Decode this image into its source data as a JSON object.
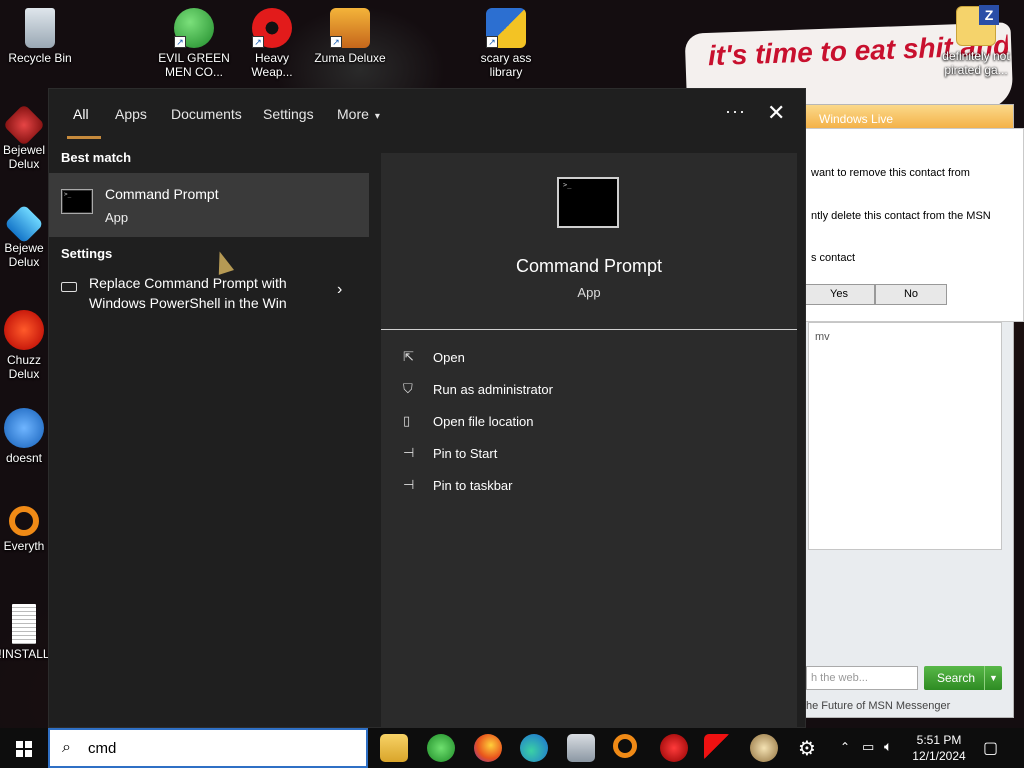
{
  "desktop": {
    "icons": [
      {
        "label": "Recycle Bin"
      },
      {
        "label": "EVIL GREEN MEN CO..."
      },
      {
        "label": "Heavy Weap..."
      },
      {
        "label": "Zuma Deluxe"
      },
      {
        "label": "scary ass library"
      },
      {
        "label": "definitely not pirated ga..."
      },
      {
        "label": "Bejewel Delux"
      },
      {
        "label": "Bejewe Delux"
      },
      {
        "label": "Chuzz Delux"
      },
      {
        "label": "doesnt"
      },
      {
        "label": "Everyth"
      },
      {
        "label": "!INSTALL"
      }
    ],
    "wallpaper_text": "it's time to eat shit and die and go trick"
  },
  "messenger": {
    "title": "Windows Live",
    "dialog_line1": "want to remove this contact from",
    "dialog_line2": "ntly delete this contact from the MSN",
    "dialog_line3": "s contact",
    "yes": "Yes",
    "no": "No",
    "list_text": "mv",
    "search_placeholder": "h the web...",
    "search_button": "Search",
    "footer": "he Future of MSN Messenger"
  },
  "search_panel": {
    "tabs": [
      "All",
      "Apps",
      "Documents",
      "Settings",
      "More"
    ],
    "more_arrow": "▾",
    "ellipsis": "···",
    "close": "✕",
    "best_match_heading": "Best match",
    "best_match": {
      "title": "Command Prompt",
      "subtitle": "App"
    },
    "settings_heading": "Settings",
    "setting_item": {
      "title": "Replace Command Prompt with Windows PowerShell in the Win"
    },
    "detail": {
      "title": "Command Prompt",
      "subtitle": "App"
    },
    "actions": [
      {
        "label": "Open",
        "icon": "open-icon"
      },
      {
        "label": "Run as administrator",
        "icon": "shield-icon"
      },
      {
        "label": "Open file location",
        "icon": "file-location-icon"
      },
      {
        "label": "Pin to Start",
        "icon": "pin-icon"
      },
      {
        "label": "Pin to taskbar",
        "icon": "pin-icon"
      }
    ]
  },
  "taskbar": {
    "search_value": "cmd",
    "time": "5:51 PM",
    "date": "12/1/2024"
  }
}
